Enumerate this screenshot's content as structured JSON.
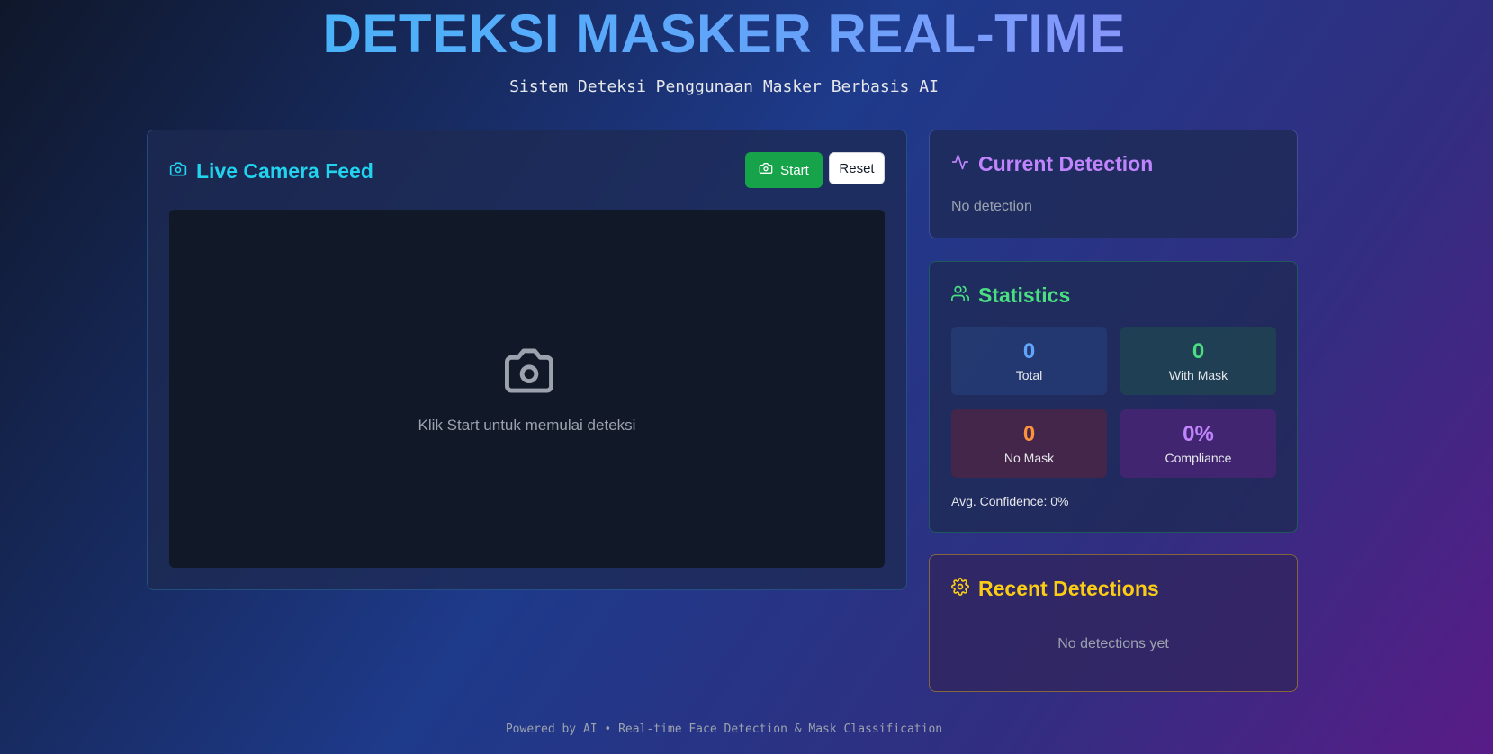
{
  "header": {
    "title": "DETEKSI MASKER REAL-TIME",
    "subtitle": "Sistem Deteksi Penggunaan Masker Berbasis AI"
  },
  "camera": {
    "title": "Live Camera Feed",
    "title_icon": "camera-icon",
    "start_label": "Start",
    "reset_label": "Reset",
    "placeholder_text": "Klik Start untuk memulai deteksi",
    "placeholder_icon": "camera-icon"
  },
  "current_detection": {
    "title": "Current Detection",
    "title_icon": "activity-icon",
    "status": "No detection"
  },
  "statistics": {
    "title": "Statistics",
    "title_icon": "users-icon",
    "total": {
      "value": "0",
      "label": "Total"
    },
    "with_mask": {
      "value": "0",
      "label": "With Mask"
    },
    "no_mask": {
      "value": "0",
      "label": "No Mask"
    },
    "compliance": {
      "value": "0%",
      "label": "Compliance"
    },
    "avg_confidence": "Avg. Confidence: 0%"
  },
  "recent": {
    "title": "Recent Detections",
    "title_icon": "gear-icon",
    "empty_text": "No detections yet"
  },
  "footer": {
    "text": "Powered by AI • Real-time Face Detection & Mask Classification"
  },
  "colors": {
    "accent_cyan": "#22d3ee",
    "start_green": "#16a34a",
    "purple": "#c084fc",
    "green": "#4ade80",
    "yellow": "#facc15",
    "orange": "#fb923c",
    "blue": "#60a5fa"
  }
}
